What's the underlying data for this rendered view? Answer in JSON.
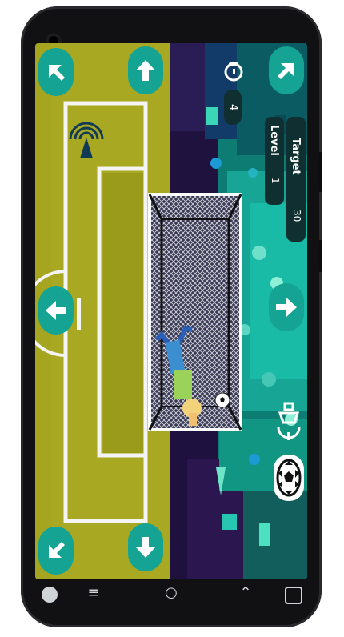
{
  "hud": {
    "score": "4",
    "level_label": "Level",
    "level_value": "1",
    "target_label": "Target",
    "target_value": "30"
  },
  "controls": {
    "arrow_icon": "arrow-icon",
    "whistle_icon": "whistle-icon",
    "ball_icon": "soccer-ball-icon",
    "torch_icon": "torch-icon",
    "radar_icon": "radar-icon"
  },
  "navigation_bar": {
    "back_label": "‹",
    "home_label": "○",
    "recents_label": "≡",
    "up_label": "⌃"
  },
  "colors": {
    "pitch": "#a7a722",
    "pitch_line": "#ffffff",
    "control": "#15a394",
    "teal_bg": "#0c7d72"
  }
}
